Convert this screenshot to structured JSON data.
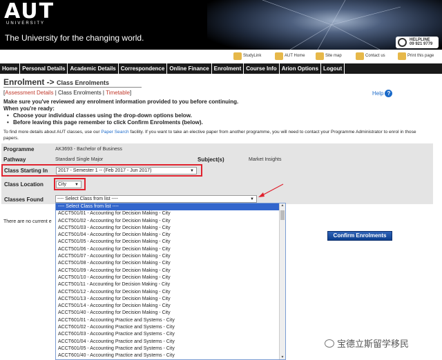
{
  "header": {
    "logo": "AUT",
    "logo_sub": "UNIVERSITY",
    "tagline": "The University for the changing world.",
    "helpline_title": "HELPLINE",
    "helpline_number": "09 921 9779"
  },
  "utility_links": [
    "StudyLink",
    "AUT Home",
    "Site map",
    "Contact us",
    "Print this page"
  ],
  "nav": [
    "Home",
    "Personal Details",
    "Academic Details",
    "Correspondence",
    "Online Finance",
    "Enrolment",
    "Course Info",
    "Arion Options",
    "Logout"
  ],
  "page_title": "Enrolment ->",
  "page_subtitle": "Class Enrolments",
  "subtabs": {
    "open": "[",
    "assessment": "Assessment Details",
    "sep1": " | ",
    "current": "Class Enrolments",
    "sep2": " | ",
    "timetable": "Timetable",
    "close": "]"
  },
  "help": "Help",
  "notice": {
    "line1": "Make sure you've reviewed any enrolment information provided to you before continuing.",
    "line2": "When you're ready:",
    "bullet1": "Choose your individual classes using the drop-down options below.",
    "bullet2": "Before leaving this page remember to click Confirm Enrolments (below)."
  },
  "info": {
    "pre": "To find more details about AUT classes, use our ",
    "link": "Paper Search",
    "post": " facility. If you want to take an elective paper from another programme, you will need to contact your Programme Administrator to enrol in those papers."
  },
  "form": {
    "programme_label": "Programme",
    "programme_value": "AK3693 - Bachelor of Business",
    "pathway_label": "Pathway",
    "pathway_value": "Standard Single Major",
    "subjects_label": "Subject(s)",
    "subjects_value": "Market Insights",
    "class_starting_label": "Class Starting In",
    "class_starting_value": "2017 - Semester 1 -- (Feb 2017 - Jun 2017)",
    "class_location_label": "Class Location",
    "class_location_value": "City",
    "classes_found_label": "Classes Found",
    "classes_found_value": "---- Select Class from list ----"
  },
  "no_current": "There are no current e",
  "confirm_button": "Confirm Enrolments",
  "dropdown_options": [
    "---- Select Class from list ----",
    "ACCT501/01 - Accounting for Decision Making - City",
    "ACCT501/02 - Accounting for Decision Making - City",
    "ACCT501/03 - Accounting for Decision Making - City",
    "ACCT501/04 - Accounting for Decision Making - City",
    "ACCT501/05 - Accounting for Decision Making - City",
    "ACCT501/06 - Accounting for Decision Making - City",
    "ACCT501/07 - Accounting for Decision Making - City",
    "ACCT501/08 - Accounting for Decision Making - City",
    "ACCT501/09 - Accounting for Decision Making - City",
    "ACCT501/10 - Accounting for Decision Making - City",
    "ACCT501/11 - Accounting for Decision Making - City",
    "ACCT501/12 - Accounting for Decision Making - City",
    "ACCT501/13 - Accounting for Decision Making - City",
    "ACCT501/14 - Accounting for Decision Making - City",
    "ACCT501/40 - Accounting for Decision Making - City",
    "ACCT601/01 - Accounting Practice and Systems - City",
    "ACCT601/02 - Accounting Practice and Systems - City",
    "ACCT601/03 - Accounting Practice and Systems - City",
    "ACCT601/04 - Accounting Practice and Systems - City",
    "ACCT601/05 - Accounting Practice and Systems - City",
    "ACCT601/40 - Accounting Practice and Systems - City"
  ],
  "watermark": "宝德立斯留学移民",
  "colors": {
    "highlight": "#e0222e",
    "link": "#1b6ac9",
    "nav_bg": "#1a1a1a",
    "button": "#1a4f9e"
  }
}
